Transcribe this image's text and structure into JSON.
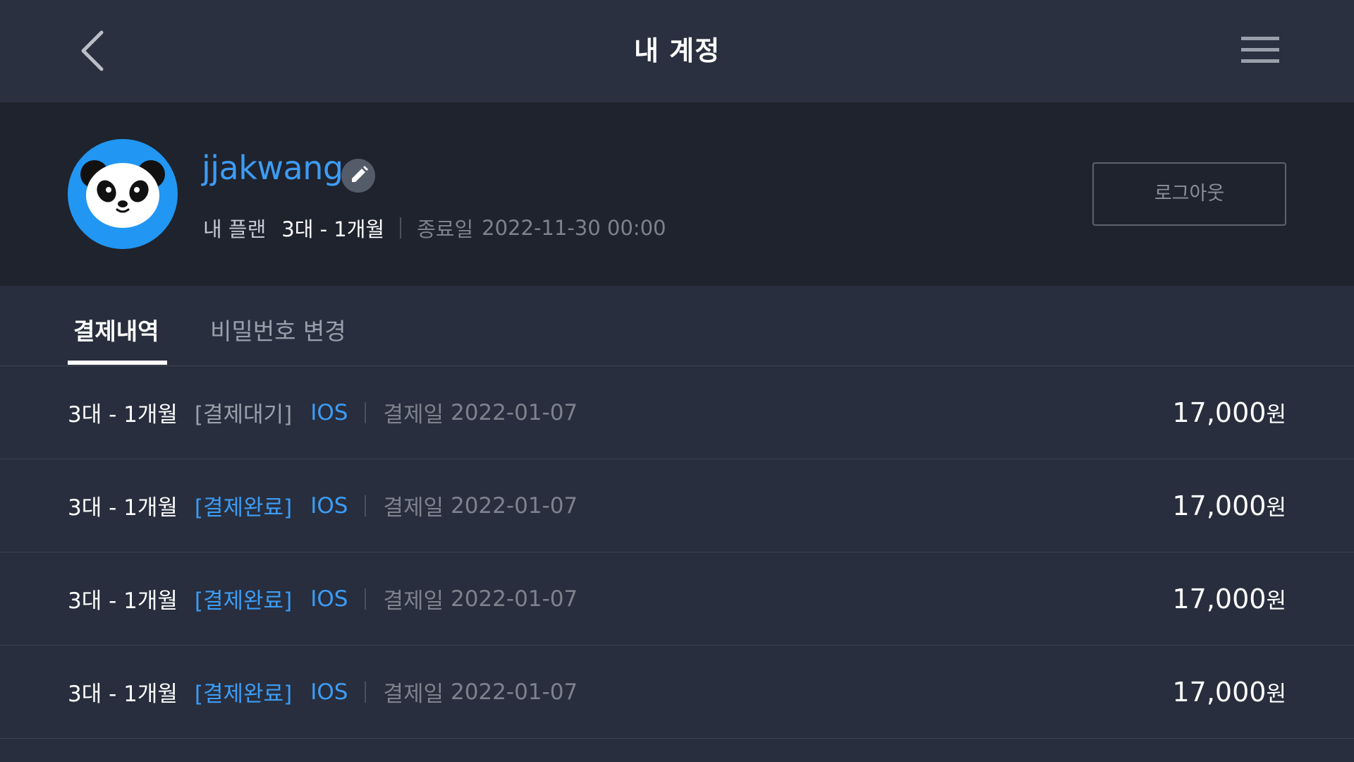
{
  "header": {
    "title": "내 계정"
  },
  "profile": {
    "username": "jjakwang",
    "plan_label": "내 플랜",
    "plan_value": "3대 - 1개월",
    "expiry_label": "종료일",
    "expiry_value": "2022-11-30 00:00",
    "logout_label": "로그아웃"
  },
  "tabs": [
    {
      "label": "결제내역",
      "active": true
    },
    {
      "label": "비밀번호 변경",
      "active": false
    }
  ],
  "payments": [
    {
      "plan": "3대 - 1개월",
      "status": "[결제대기]",
      "platform": "IOS",
      "date_label": "결제일",
      "date": "2022-01-07",
      "amount": "17,000",
      "unit": "원"
    },
    {
      "plan": "3대 - 1개월",
      "status": "[결제완료]",
      "platform": "IOS",
      "date_label": "결제일",
      "date": "2022-01-07",
      "amount": "17,000",
      "unit": "원"
    },
    {
      "plan": "3대 - 1개월",
      "status": "[결제완료]",
      "platform": "IOS",
      "date_label": "결제일",
      "date": "2022-01-07",
      "amount": "17,000",
      "unit": "원"
    },
    {
      "plan": "3대 - 1개월",
      "status": "[결제완료]",
      "platform": "IOS",
      "date_label": "결제일",
      "date": "2022-01-07",
      "amount": "17,000",
      "unit": "원"
    }
  ],
  "colors": {
    "background": "#282e3d",
    "profile_background": "#1f232d",
    "accent": "#3d9cf5",
    "avatar_background": "#2196f3"
  },
  "icons": {
    "back": "chevron-left-icon",
    "menu": "hamburger-menu-icon",
    "edit": "pencil-icon",
    "avatar": "panda-icon"
  }
}
